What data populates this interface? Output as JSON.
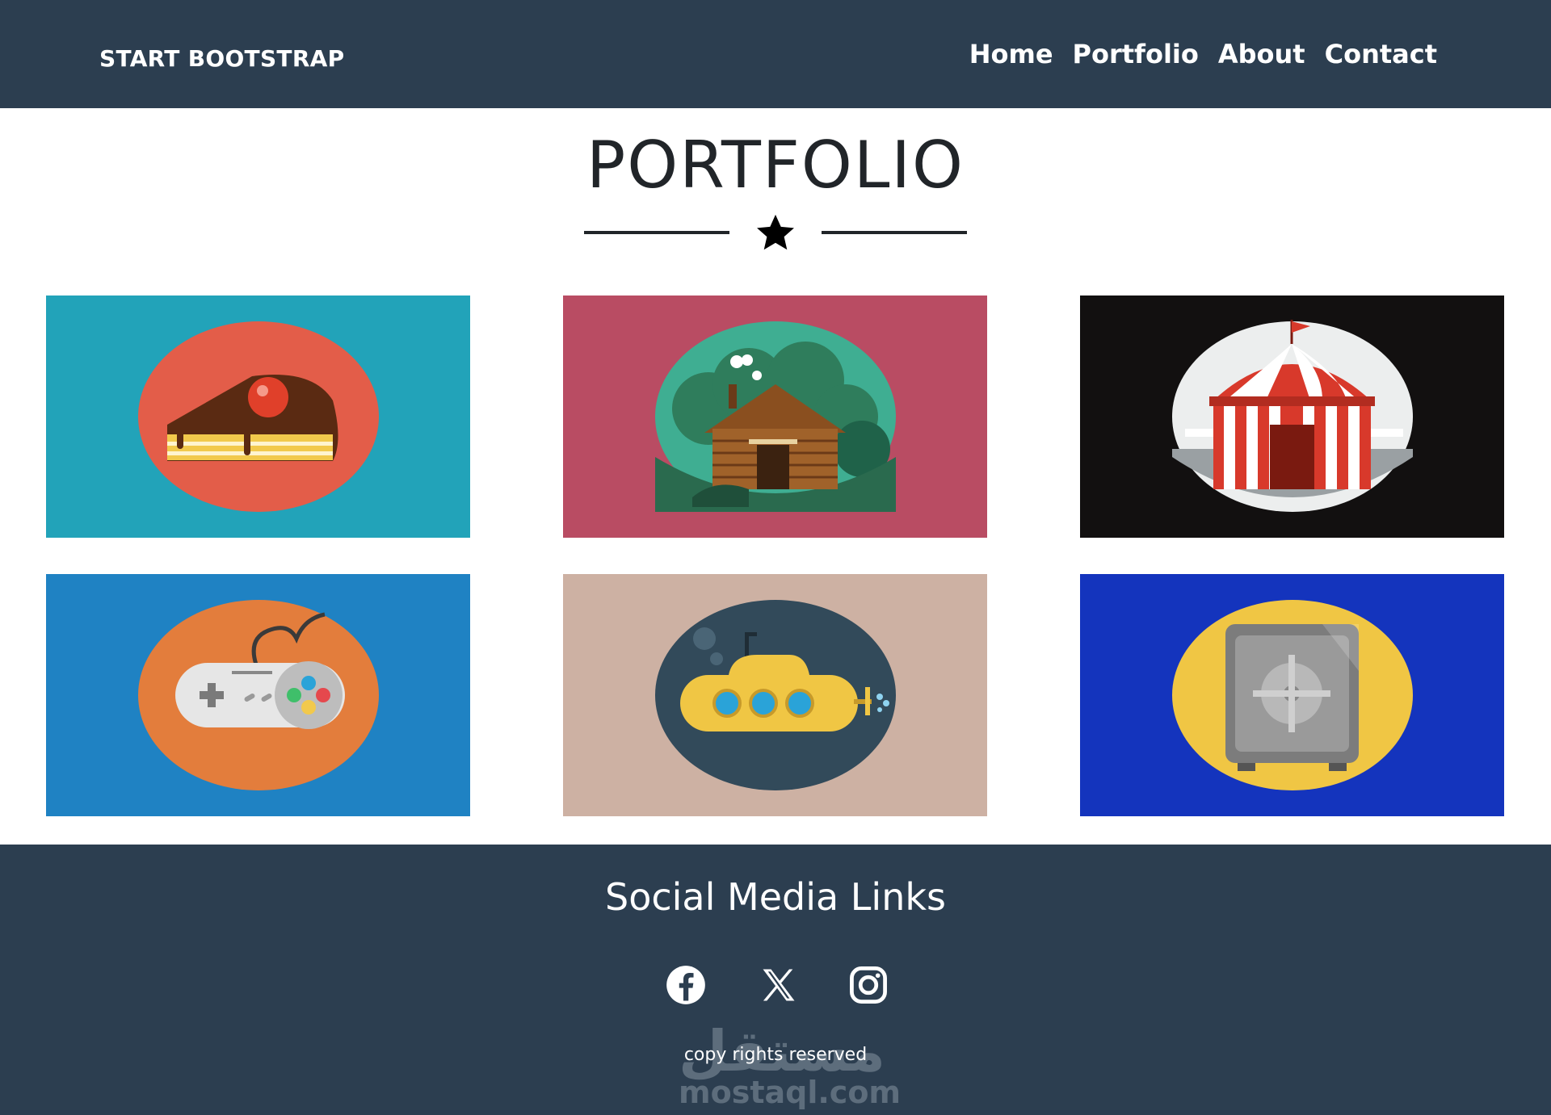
{
  "navbar": {
    "brand": "START BOOTSTRAP",
    "links": [
      "Home",
      "Portfolio",
      "About",
      "Contact"
    ]
  },
  "portfolio": {
    "title": "PORTFOLIO",
    "items": [
      {
        "icon": "cake-icon",
        "background": "#22a3b9",
        "circle": "#e35d49"
      },
      {
        "icon": "cabin-icon",
        "background": "#b94c63",
        "circle": "#3fae92"
      },
      {
        "icon": "circus-tent-icon",
        "background": "#121010",
        "circle": "#eceeee"
      },
      {
        "icon": "game-controller-icon",
        "background": "#1f82c3",
        "circle": "#e37d3c"
      },
      {
        "icon": "submarine-icon",
        "background": "#cdb1a3",
        "circle": "#324a5a"
      },
      {
        "icon": "safe-icon",
        "background": "#1434bd",
        "circle": "#f0c644"
      }
    ]
  },
  "footer": {
    "title": "Social Media Links",
    "social": [
      "facebook-icon",
      "x-icon",
      "instagram-icon"
    ],
    "copyright": "copy rights reserved",
    "watermark": {
      "arabic": "مستقل",
      "latin": "mostaql.com"
    }
  },
  "colors": {
    "nav_bg": "#2c3e50",
    "footer_bg": "#2c3e50",
    "text": "#212529"
  }
}
